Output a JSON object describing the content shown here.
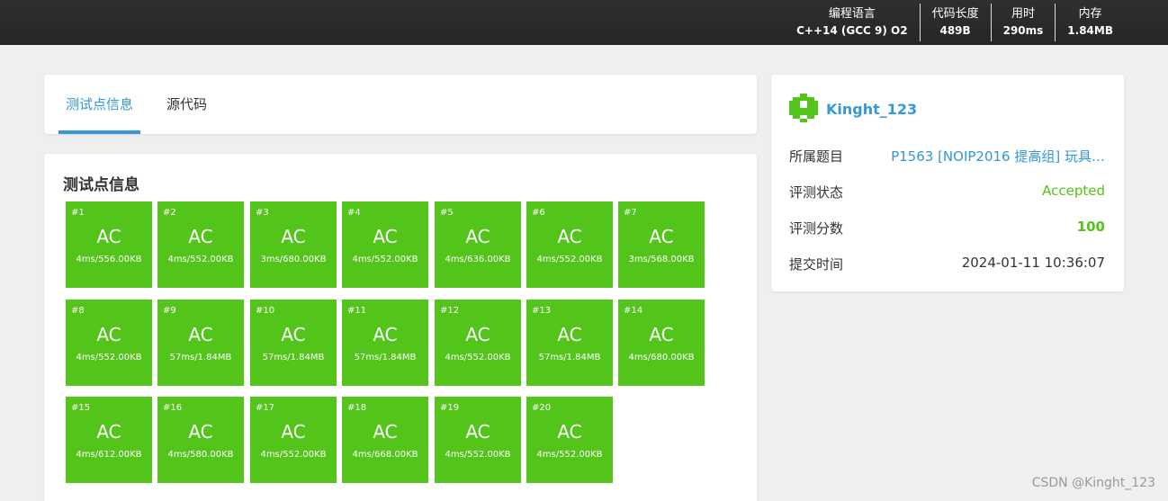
{
  "topbar": {
    "stats": [
      {
        "label": "编程语言",
        "value": "C++14 (GCC 9) O2"
      },
      {
        "label": "代码长度",
        "value": "489B"
      },
      {
        "label": "用时",
        "value": "290ms"
      },
      {
        "label": "内存",
        "value": "1.84MB"
      }
    ]
  },
  "tabs": [
    {
      "label": "测试点信息"
    },
    {
      "label": "源代码"
    }
  ],
  "tests": {
    "title": "测试点信息",
    "cases": [
      {
        "num": "#1",
        "status": "AC",
        "meta": "4ms/556.00KB"
      },
      {
        "num": "#2",
        "status": "AC",
        "meta": "4ms/552.00KB"
      },
      {
        "num": "#3",
        "status": "AC",
        "meta": "3ms/680.00KB"
      },
      {
        "num": "#4",
        "status": "AC",
        "meta": "4ms/552.00KB"
      },
      {
        "num": "#5",
        "status": "AC",
        "meta": "4ms/636.00KB"
      },
      {
        "num": "#6",
        "status": "AC",
        "meta": "4ms/552.00KB"
      },
      {
        "num": "#7",
        "status": "AC",
        "meta": "3ms/568.00KB"
      },
      {
        "num": "#8",
        "status": "AC",
        "meta": "4ms/552.00KB"
      },
      {
        "num": "#9",
        "status": "AC",
        "meta": "57ms/1.84MB"
      },
      {
        "num": "#10",
        "status": "AC",
        "meta": "57ms/1.84MB"
      },
      {
        "num": "#11",
        "status": "AC",
        "meta": "57ms/1.84MB"
      },
      {
        "num": "#12",
        "status": "AC",
        "meta": "4ms/552.00KB"
      },
      {
        "num": "#13",
        "status": "AC",
        "meta": "57ms/1.84MB"
      },
      {
        "num": "#14",
        "status": "AC",
        "meta": "4ms/680.00KB"
      },
      {
        "num": "#15",
        "status": "AC",
        "meta": "4ms/612.00KB"
      },
      {
        "num": "#16",
        "status": "AC",
        "meta": "4ms/580.00KB"
      },
      {
        "num": "#17",
        "status": "AC",
        "meta": "4ms/552.00KB"
      },
      {
        "num": "#18",
        "status": "AC",
        "meta": "4ms/668.00KB"
      },
      {
        "num": "#19",
        "status": "AC",
        "meta": "4ms/552.00KB"
      },
      {
        "num": "#20",
        "status": "AC",
        "meta": "4ms/552.00KB"
      }
    ]
  },
  "info": {
    "username": "Kinght_123",
    "rows": [
      {
        "key": "所属题目",
        "value": "P1563 [NOIP2016 提高组] 玩具…"
      },
      {
        "key": "评测状态",
        "value": "Accepted"
      },
      {
        "key": "评测分数",
        "value": "100"
      },
      {
        "key": "提交时间",
        "value": "2024-01-11 10:36:07"
      }
    ]
  },
  "colors": {
    "accent": "#3498db",
    "ac_green": "#52c41a",
    "topbar": "#2a2a2a"
  },
  "watermark": "CSDN @Kinght_123"
}
